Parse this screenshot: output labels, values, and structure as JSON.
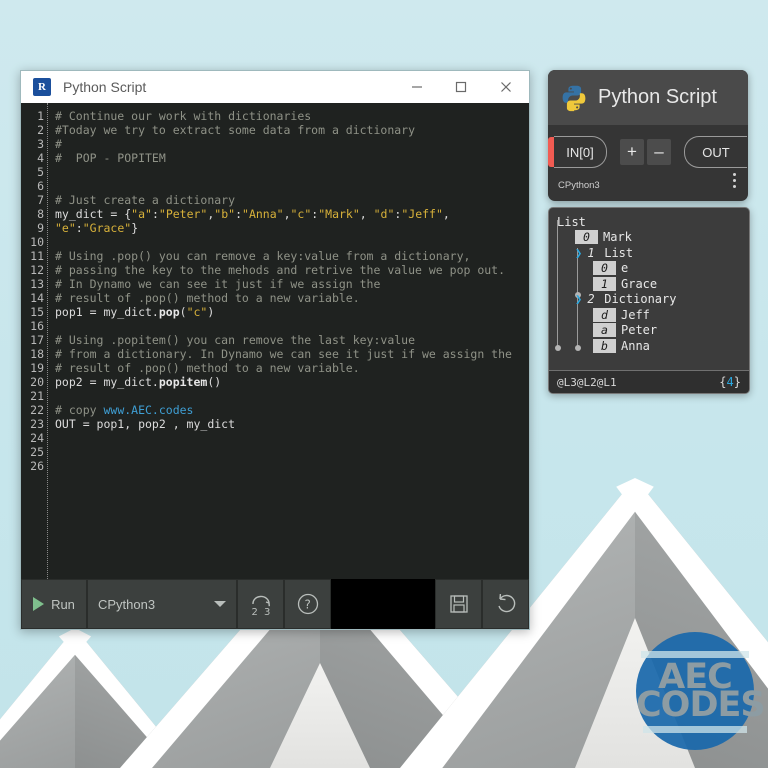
{
  "background": {
    "description": "photo of gray gabled roofs against light blue sky",
    "sky_color": "#c8e7ec",
    "roof_color": "#9a9d9d"
  },
  "logo": {
    "line1": "AEC",
    "line2": "CODES",
    "disc_color": "#1a68ab",
    "text_color": "#8d9ca3"
  },
  "editor_window": {
    "icon": "revit-icon",
    "icon_letter": "R",
    "title": "Python Script",
    "window_buttons": {
      "minimize": "–",
      "maximize": "☐",
      "close": "✕"
    },
    "line_numbers": [
      "1",
      "2",
      "3",
      "4",
      "5",
      "6",
      "7",
      "8",
      "9",
      "10",
      "11",
      "12",
      "13",
      "14",
      "15",
      "16",
      "17",
      "18",
      "19",
      "20",
      "21",
      "22",
      "23",
      "24",
      "25",
      "26"
    ],
    "code_lines": [
      {
        "n": 1,
        "tokens": [
          {
            "t": "# Continue our work with dictionaries",
            "c": "com"
          }
        ]
      },
      {
        "n": 2,
        "tokens": [
          {
            "t": "#Today we try to extract some data from a dictionary",
            "c": "com"
          }
        ]
      },
      {
        "n": 3,
        "tokens": [
          {
            "t": "#",
            "c": "com"
          }
        ]
      },
      {
        "n": 4,
        "tokens": [
          {
            "t": "#  POP - POPITEM",
            "c": "com"
          }
        ]
      },
      {
        "n": 5,
        "tokens": []
      },
      {
        "n": 6,
        "tokens": []
      },
      {
        "n": 7,
        "tokens": [
          {
            "t": "# Just create a dictionary",
            "c": "com"
          }
        ]
      },
      {
        "n": 8,
        "tokens": [
          {
            "t": "my_dict = {",
            "c": "id"
          },
          {
            "t": "\"a\"",
            "c": "str"
          },
          {
            "t": ":",
            "c": "id"
          },
          {
            "t": "\"Peter\"",
            "c": "str"
          },
          {
            "t": ",",
            "c": "id"
          },
          {
            "t": "\"b\"",
            "c": "str"
          },
          {
            "t": ":",
            "c": "id"
          },
          {
            "t": "\"Anna\"",
            "c": "str"
          },
          {
            "t": ",",
            "c": "id"
          },
          {
            "t": "\"c\"",
            "c": "str"
          },
          {
            "t": ":",
            "c": "id"
          },
          {
            "t": "\"Mark\"",
            "c": "str"
          },
          {
            "t": ", ",
            "c": "id"
          },
          {
            "t": "\"d\"",
            "c": "str"
          },
          {
            "t": ":",
            "c": "id"
          },
          {
            "t": "\"Jeff\"",
            "c": "str"
          },
          {
            "t": ",",
            "c": "id"
          }
        ]
      },
      {
        "n": 9,
        "tokens": [
          {
            "t": "\"e\"",
            "c": "str"
          },
          {
            "t": ":",
            "c": "id"
          },
          {
            "t": "\"Grace\"",
            "c": "str"
          },
          {
            "t": "}",
            "c": "id"
          }
        ]
      },
      {
        "n": 10,
        "tokens": []
      },
      {
        "n": 11,
        "tokens": [
          {
            "t": "# Using .pop() you can remove a key:value from a dictionary,",
            "c": "com"
          }
        ]
      },
      {
        "n": 12,
        "tokens": [
          {
            "t": "# passing the key to the mehods and retrive the value we pop out.",
            "c": "com"
          }
        ]
      },
      {
        "n": 13,
        "tokens": [
          {
            "t": "# In Dynamo we can see it just if we assign the",
            "c": "com"
          }
        ]
      },
      {
        "n": 14,
        "tokens": [
          {
            "t": "# result of .pop() method to a new variable.",
            "c": "com"
          }
        ]
      },
      {
        "n": 15,
        "tokens": [
          {
            "t": "pop1 = my_dict.",
            "c": "id"
          },
          {
            "t": "pop",
            "c": "fn"
          },
          {
            "t": "(",
            "c": "id"
          },
          {
            "t": "\"c\"",
            "c": "str"
          },
          {
            "t": ")",
            "c": "id"
          }
        ]
      },
      {
        "n": 16,
        "tokens": []
      },
      {
        "n": 17,
        "tokens": [
          {
            "t": "# Using .popitem() you can remove the last key:value",
            "c": "com"
          }
        ]
      },
      {
        "n": 18,
        "tokens": [
          {
            "t": "# from a dictionary. In Dynamo we can see it just if we assign the",
            "c": "com"
          }
        ]
      },
      {
        "n": 19,
        "tokens": [
          {
            "t": "# result of .pop() method to a new variable.",
            "c": "com"
          }
        ]
      },
      {
        "n": 20,
        "tokens": [
          {
            "t": "pop2 = my_dict.",
            "c": "id"
          },
          {
            "t": "popitem",
            "c": "fn"
          },
          {
            "t": "()",
            "c": "id"
          }
        ]
      },
      {
        "n": 21,
        "tokens": []
      },
      {
        "n": 22,
        "tokens": [
          {
            "t": "# copy ",
            "c": "com"
          },
          {
            "t": "www.AEC.codes",
            "c": "url"
          }
        ]
      },
      {
        "n": 23,
        "tokens": [
          {
            "t": "OUT = pop1, pop2 , my_dict",
            "c": "id"
          }
        ]
      },
      {
        "n": 24,
        "tokens": []
      },
      {
        "n": 25,
        "tokens": []
      },
      {
        "n": 26,
        "tokens": []
      }
    ],
    "toolbar": {
      "run_label": "Run",
      "engine_value": "CPython3",
      "migrate_label": "2 3",
      "help_label": "?",
      "save_label": "save-icon",
      "revert_label": "revert-icon"
    }
  },
  "dynamo_node": {
    "title": "Python Script",
    "logo": "python-logo",
    "input_port": "IN[0]",
    "add_button": "+",
    "remove_button": "–",
    "output_port": "OUT",
    "engine_label": "CPython3",
    "accent_unconnected": "#f15b52"
  },
  "preview": {
    "rows": [
      {
        "indent": 0,
        "chevron": "",
        "badge": "",
        "plain_index": "",
        "label": "List",
        "badge_style": "none"
      },
      {
        "indent": 1,
        "chevron": "",
        "badge": "0",
        "plain_index": "",
        "label": "Mark",
        "badge_style": "box"
      },
      {
        "indent": 1,
        "chevron": "❯",
        "badge": "",
        "plain_index": "1",
        "label": "List",
        "badge_style": "plain"
      },
      {
        "indent": 2,
        "chevron": "",
        "badge": "0",
        "plain_index": "",
        "label": "e",
        "badge_style": "box"
      },
      {
        "indent": 2,
        "chevron": "",
        "badge": "1",
        "plain_index": "",
        "label": "Grace",
        "badge_style": "box"
      },
      {
        "indent": 1,
        "chevron": "❯",
        "badge": "",
        "plain_index": "2",
        "label": "Dictionary",
        "badge_style": "plain"
      },
      {
        "indent": 2,
        "chevron": "",
        "badge": "d",
        "plain_index": "",
        "label": "Jeff",
        "badge_style": "box"
      },
      {
        "indent": 2,
        "chevron": "",
        "badge": "a",
        "plain_index": "",
        "label": "Peter",
        "badge_style": "box"
      },
      {
        "indent": 2,
        "chevron": "",
        "badge": "b",
        "plain_index": "",
        "label": "Anna",
        "badge_style": "box"
      }
    ],
    "footer_levels": "@L3@L2@L1",
    "footer_count_open": "{",
    "footer_count": "4",
    "footer_count_close": "}"
  }
}
